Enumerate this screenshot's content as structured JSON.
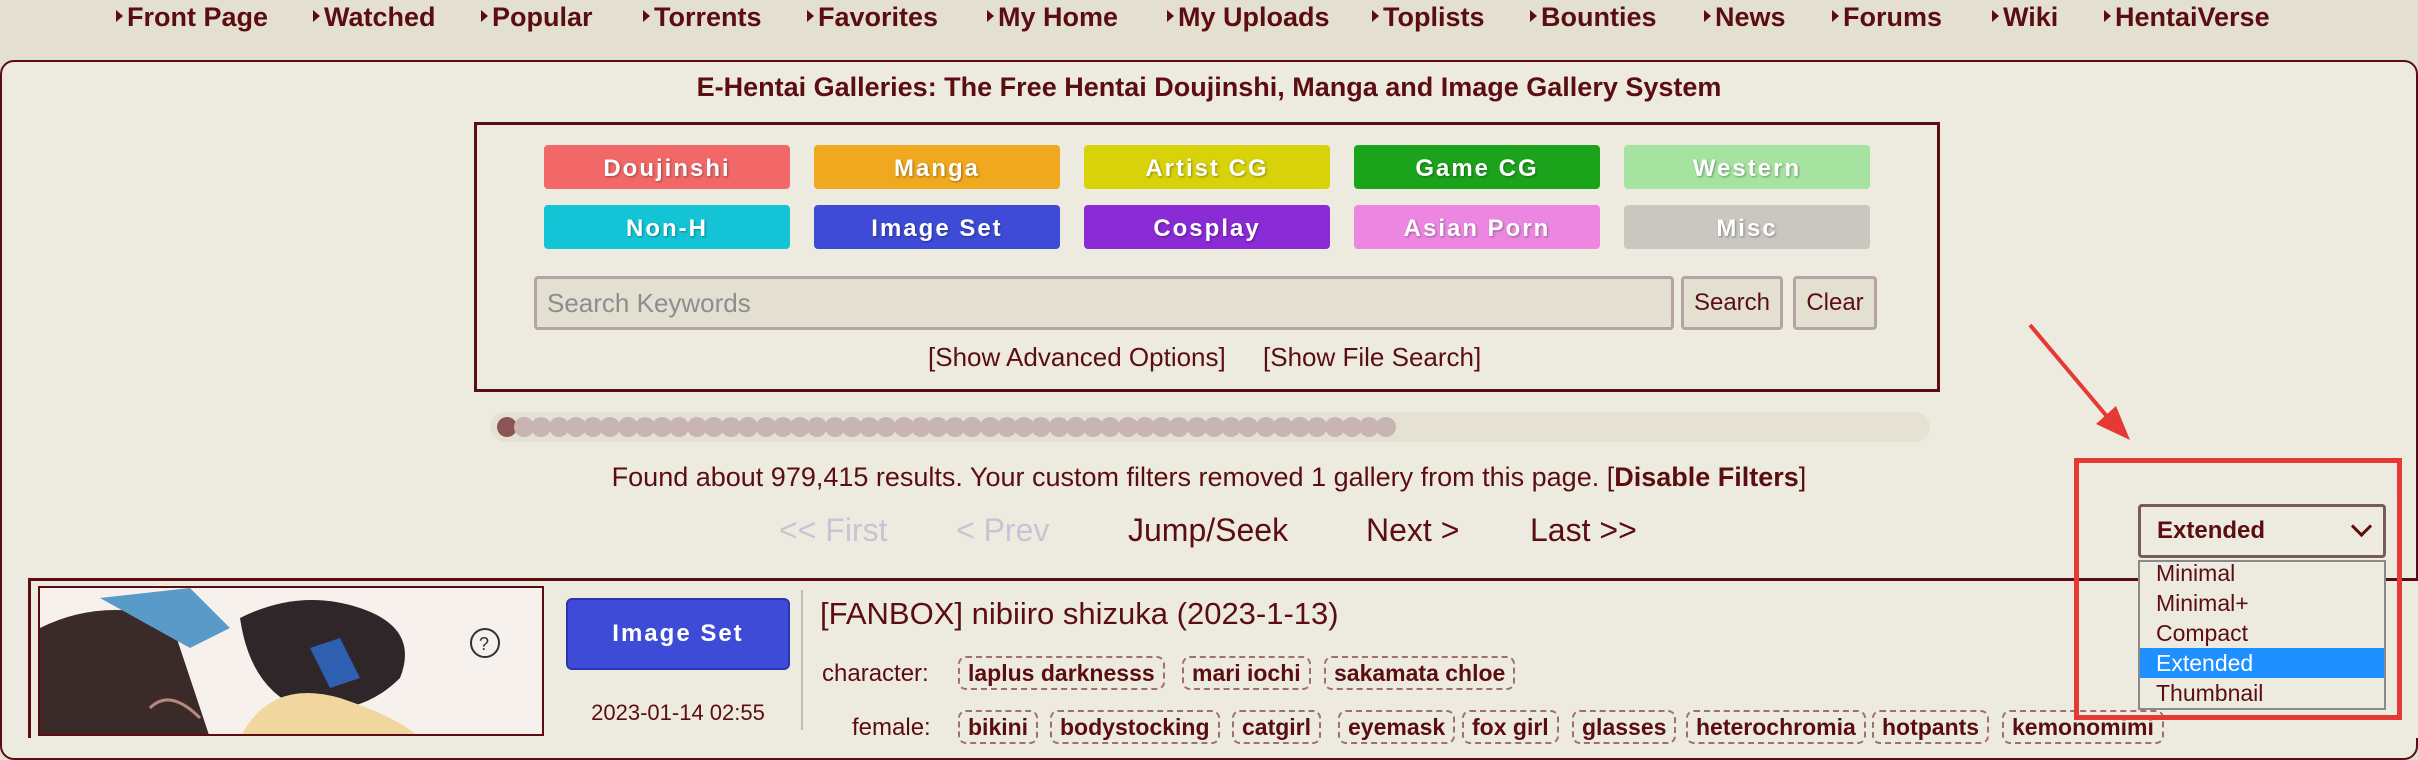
{
  "nav": {
    "items": [
      {
        "label": "Front Page"
      },
      {
        "label": "Watched"
      },
      {
        "label": "Popular"
      },
      {
        "label": "Torrents"
      },
      {
        "label": "Favorites"
      },
      {
        "label": "My Home"
      },
      {
        "label": "My Uploads"
      },
      {
        "label": "Toplists"
      },
      {
        "label": "Bounties"
      },
      {
        "label": "News"
      },
      {
        "label": "Forums"
      },
      {
        "label": "Wiki"
      },
      {
        "label": "HentaiVerse"
      }
    ]
  },
  "header": {
    "title": "E-Hentai Galleries: The Free Hentai Doujinshi, Manga and Image Gallery System"
  },
  "categories": [
    {
      "label": "Doujinshi",
      "color": "#F26767"
    },
    {
      "label": "Manga",
      "color": "#F0A81E"
    },
    {
      "label": "Artist CG",
      "color": "#D7D20A"
    },
    {
      "label": "Game CG",
      "color": "#1CA31C"
    },
    {
      "label": "Western",
      "color": "#A6E3A0"
    },
    {
      "label": "Non-H",
      "color": "#13C4D6"
    },
    {
      "label": "Image Set",
      "color": "#3D4BD6"
    },
    {
      "label": "Cosplay",
      "color": "#8A2BD6"
    },
    {
      "label": "Asian Porn",
      "color": "#EC86E0"
    },
    {
      "label": "Misc",
      "color": "#C9C7C0"
    }
  ],
  "search": {
    "placeholder": "Search Keywords",
    "search_label": "Search",
    "clear_label": "Clear",
    "advanced_label": "[Show Advanced Options]",
    "file_search_label": "[Show File Search]"
  },
  "results": {
    "prefix": "Found about 979,415 results. Your custom filters removed 1 gallery from this page. [",
    "disable_label": "Disable Filters",
    "suffix": "]"
  },
  "pager": {
    "first": "<< First",
    "prev": "< Prev",
    "jump": "Jump/Seek",
    "next": "Next >",
    "last": "Last >>"
  },
  "display_mode": {
    "selected": "Extended",
    "options": [
      "Minimal",
      "Minimal+",
      "Compact",
      "Extended",
      "Thumbnail"
    ]
  },
  "gallery": {
    "category": "Image Set",
    "date": "2023-01-14 02:55",
    "title": "[FANBOX] nibiiro shizuka (2023-1-13)",
    "character_label": "character:",
    "character_tags": [
      "laplus darknesss",
      "mari iochi",
      "sakamata chloe"
    ],
    "female_label": "female:",
    "female_tags": [
      "bikini",
      "bodystocking",
      "catgirl",
      "eyemask",
      "fox girl",
      "glasses",
      "heterochromia",
      "hotpants",
      "kemonomimi"
    ]
  }
}
